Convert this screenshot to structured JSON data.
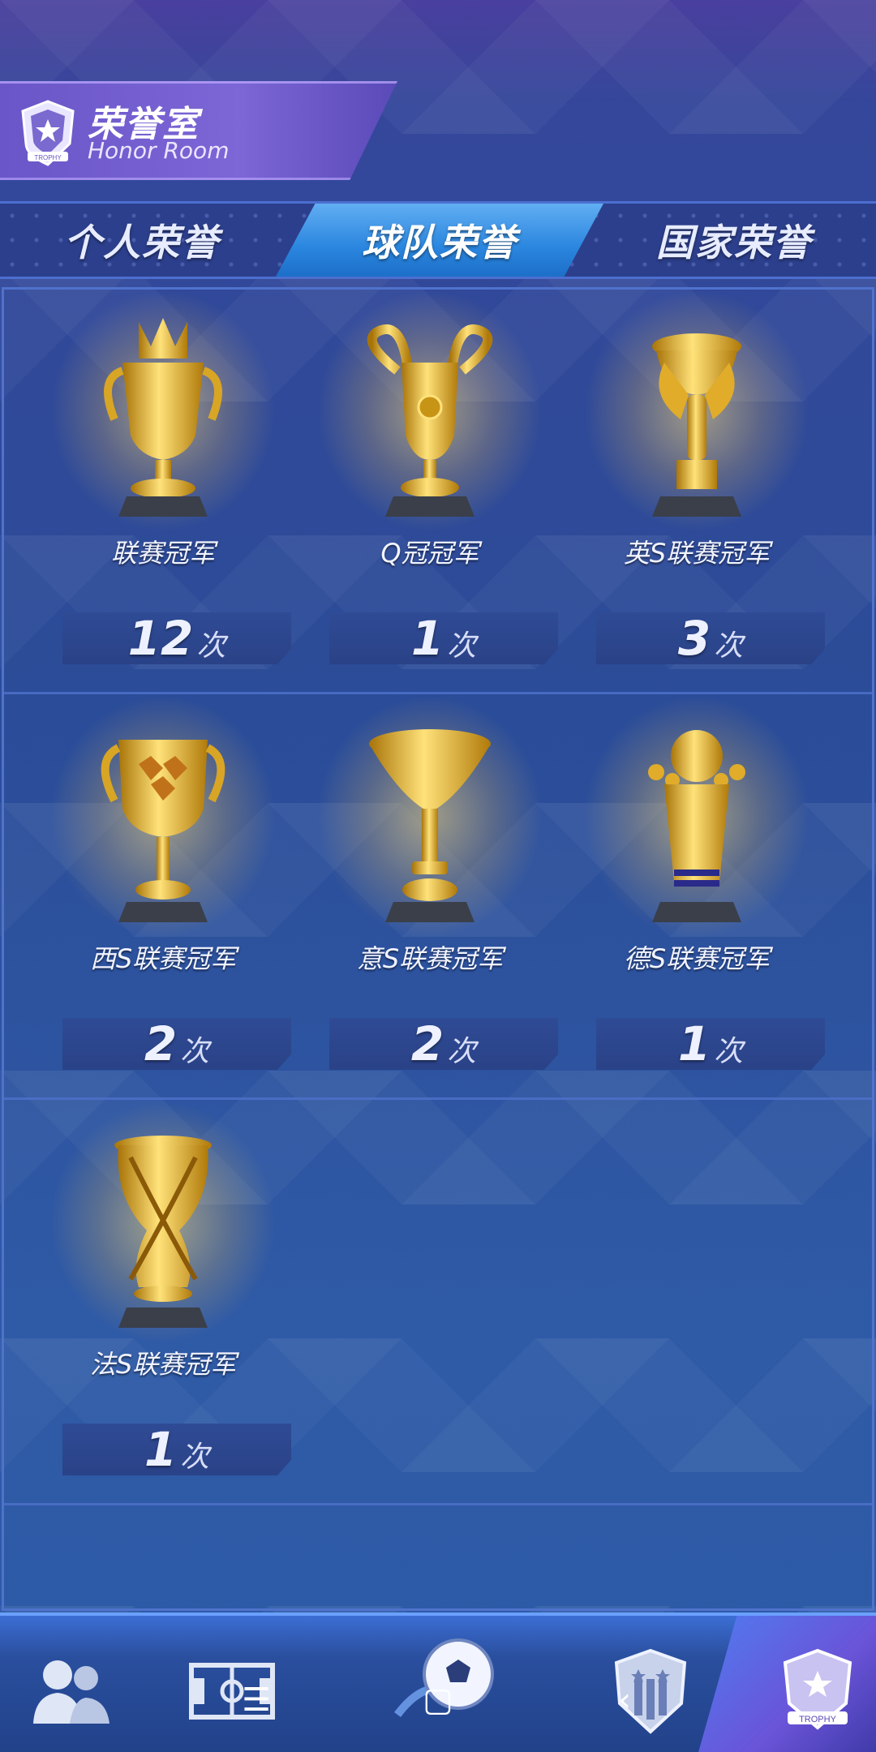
{
  "header": {
    "title_cn": "荣誉室",
    "title_en": "Honor Room",
    "badge_text": "TROPHY"
  },
  "tabs": [
    {
      "label": "个人荣誉",
      "active": false
    },
    {
      "label": "球队荣誉",
      "active": true
    },
    {
      "label": "国家荣誉",
      "active": false
    }
  ],
  "trophies": [
    {
      "name": "联赛冠军",
      "count": "12",
      "unit": "次",
      "icon": "league-trophy-icon"
    },
    {
      "name": "Q冠冠军",
      "count": "1",
      "unit": "次",
      "icon": "big-ears-cup-icon"
    },
    {
      "name": "英S联赛冠军",
      "count": "3",
      "unit": "次",
      "icon": "winged-trophy-icon"
    },
    {
      "name": "西S联赛冠军",
      "count": "2",
      "unit": "次",
      "icon": "diamond-cup-icon"
    },
    {
      "name": "意S联赛冠军",
      "count": "2",
      "unit": "次",
      "icon": "funnel-trophy-icon"
    },
    {
      "name": "德S联赛冠军",
      "count": "1",
      "unit": "次",
      "icon": "globe-trophy-icon"
    },
    {
      "name": "法S联赛冠军",
      "count": "1",
      "unit": "次",
      "icon": "twisted-trophy-icon"
    }
  ],
  "bottom_nav": {
    "items": [
      {
        "icon": "players-icon"
      },
      {
        "icon": "pitch-icon"
      },
      {
        "icon": "football-icon"
      },
      {
        "icon": "club-crest-icon"
      },
      {
        "icon": "trophy-room-icon",
        "label": "TROPHY",
        "active": true
      }
    ],
    "system": {
      "menu": "☰",
      "home": "▢",
      "back": "‹"
    }
  },
  "colors": {
    "gold": "#f4c542",
    "gold_dark": "#b8860b",
    "tab_active": "#2a86df",
    "accent_border": "#4f72cc"
  }
}
